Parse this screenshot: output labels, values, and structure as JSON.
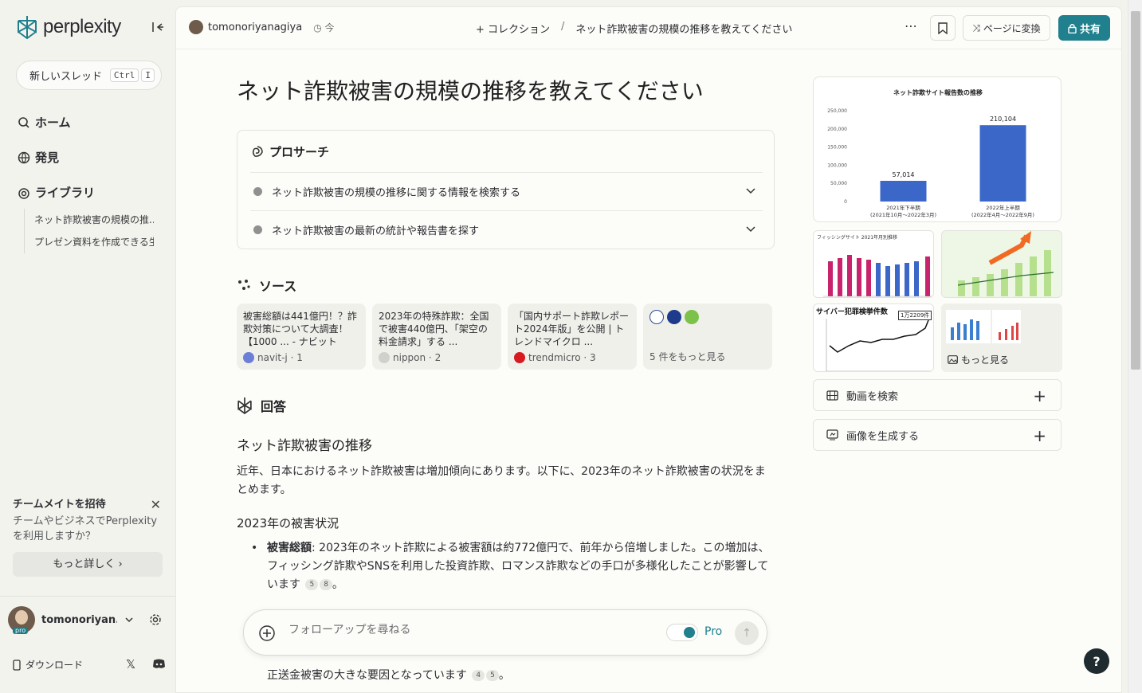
{
  "sidebar": {
    "logo_text": "perplexity",
    "new_thread": {
      "label": "新しいスレッド",
      "kbd": [
        "Ctrl",
        "I"
      ]
    },
    "nav": [
      {
        "label": "ホーム",
        "icon": "search-icon"
      },
      {
        "label": "発見",
        "icon": "globe-icon"
      },
      {
        "label": "ライブラリ",
        "icon": "library-icon"
      }
    ],
    "library_items": [
      "ネット詐欺被害の規模の推...",
      "プレゼン資料を作成できる生..."
    ],
    "invite": {
      "title": "チームメイトを招待",
      "desc": "チームやビジネスでPerplexityを利用しますか？",
      "more": "もっと詳しく ›"
    },
    "user": {
      "name": "tomonoriyan...",
      "badge": "pro"
    },
    "download": "ダウンロード"
  },
  "topbar": {
    "user": "tomonoriyanagiya",
    "time": "今",
    "collection": "+ コレクション",
    "separator": "/",
    "thread_title": "ネット詐欺被害の規模の推移を教えてください",
    "convert": "ページに変換",
    "share": "共有"
  },
  "main": {
    "title": "ネット詐欺被害の規模の推移を教えてください",
    "pro_search": {
      "label": "プロサーチ",
      "steps": [
        "ネット詐欺被害の規模の推移に関する情報を検索する",
        "ネット詐欺被害の最新の統計や報告書を探す"
      ]
    },
    "sources_label": "ソース",
    "sources": [
      {
        "text": "被害総額は441億円！？詐欺対策について大調査！【1000 ... - ナビット",
        "site": "navit-j · 1",
        "color": "#6b7fd7"
      },
      {
        "text": "2023年の特殊詐欺：全国で被害440億円､「架空の料金請求」する ...",
        "site": "nippon · 2",
        "color": "#cfd1cc"
      },
      {
        "text": "「国内サポート詐欺レポート2024年版」を公開 | トレンドマイクロ ...",
        "site": "trendmicro · 3",
        "color": "#d71920"
      }
    ],
    "sources_more": "5 件をもっと見る",
    "answer_label": "回答",
    "answer": {
      "h2": "ネット詐欺被害の推移",
      "p": "近年、日本におけるネット詐欺被害は増加傾向にあります。以下に、2023年のネット詐欺被害の状況をまとめます。",
      "h3": "2023年の被害状況",
      "li_bold": "被害総額",
      "li_text": ": 2023年のネット詐欺による被害額は約772億円で、前年から倍増しました。この増加は、フィッシング詐欺やSNSを利用した投資詐欺、ロマンス詐欺などの手口が多様化したことが影響しています",
      "li_cites": [
        "5",
        "8"
      ],
      "tail_text": "正送金被害の大きな要因となっています",
      "tail_cites": [
        "4",
        "5"
      ]
    },
    "followup": {
      "placeholder": "フォローアップを尋ねる",
      "pro": "Pro"
    }
  },
  "right": {
    "chart_title": "ネット詐欺サイト報告数の推移",
    "thumb1_title": "フィッシングサイト 2021年月別推移",
    "thumb3_title": "サイバー犯罪検挙件数",
    "thumb3_badge": "1万2209件",
    "more_images": "もっと見る",
    "search_video": "動画を検索",
    "generate_image": "画像を生成する"
  },
  "chart_data": {
    "type": "bar",
    "title": "ネット詐欺サイト報告数の推移",
    "categories": [
      "2021年下半期\n(2021年10月～2022年3月)",
      "2022年上半期\n(2022年4月～2022年9月)"
    ],
    "category_lines": [
      [
        "2021年下半期",
        "(2021年10月～2022年3月)"
      ],
      [
        "2022年上半期",
        "(2022年4月～2022年9月)"
      ]
    ],
    "values": [
      57014,
      210104
    ],
    "value_labels": [
      "57,014",
      "210,104"
    ],
    "yticks": [
      "250,000",
      "200,000",
      "150,000",
      "100,000",
      "50,000",
      "0"
    ],
    "ylim": [
      0,
      250000
    ],
    "color": "#3b67c9"
  }
}
